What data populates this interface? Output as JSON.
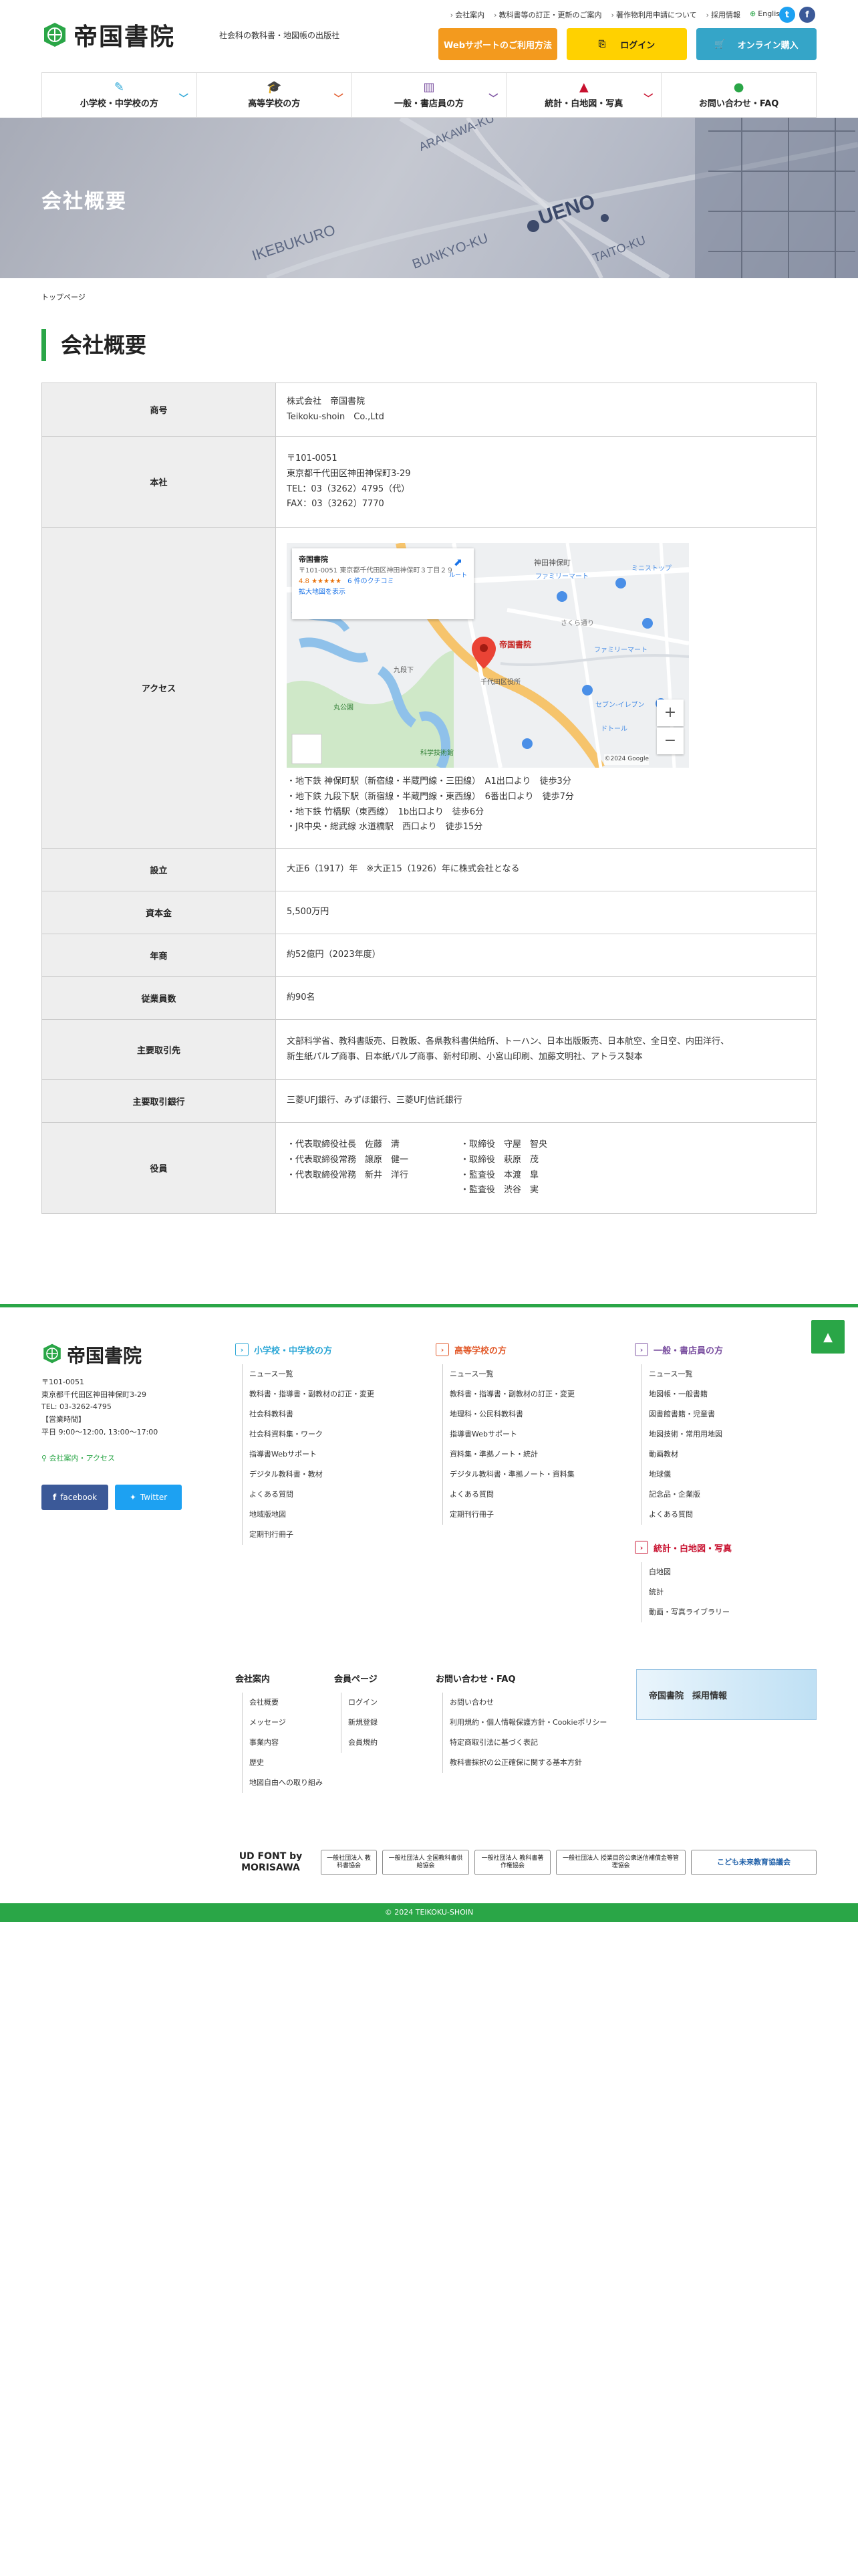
{
  "header": {
    "logo": "帝国書院",
    "tagline": "社会科の教科書・地図帳の出版社",
    "toplinks": [
      "会社案内",
      "教科書等の訂正・更新のご案内",
      "著作物利用申請について",
      "採用情報",
      "English"
    ],
    "buttons": {
      "web_support": "Webサポートのご利用方法",
      "login": "ログイン",
      "online": "オンライン購入"
    }
  },
  "nav": [
    "小学校・中学校の方",
    "高等学校の方",
    "一般・書店員の方",
    "統計・白地図・写真",
    "お問い合わせ・FAQ"
  ],
  "hero": {
    "title": "会社概要"
  },
  "breadcrumb": "トップページ",
  "page_title": "会社概要",
  "company": {
    "name_label": "商号",
    "name_lines": [
      "株式会社　帝国書院",
      "Teikoku-shoin　Co.,Ltd"
    ],
    "office_label": "本社",
    "office_lines": [
      "〒101-0051",
      "東京都千代田区神田神保町3-29",
      "TEL：03（3262）4795（代）",
      "FAX：03（3262）7770"
    ],
    "access_label": "アクセス",
    "map": {
      "card_title": "帝国書院",
      "card_address": "〒101-0051 東京都千代田区神田神保町３丁目２９",
      "card_rating": "4.8 ★★★★★",
      "card_reviews": "6 件のクチコミ",
      "card_link": "拡大地図を表示",
      "route": "ルート",
      "marker": "帝国書院",
      "labels": [
        "神田神保町",
        "ファミリーマート",
        "さくら通り",
        "ファミリーマート",
        "セブン-イレブン",
        "千代田区役所",
        "丸公園",
        "科学技術館",
        "ミニストップ",
        "ドトール",
        "九段下"
      ],
      "zoom_in": "+",
      "zoom_out": "−",
      "copyright": "©2024 Google"
    },
    "access_lines": [
      "・地下鉄 神保町駅（新宿線・半蔵門線・三田線）　A1出口より　徒歩3分",
      "・地下鉄 九段下駅（新宿線・半蔵門線・東西線）　6番出口より　徒歩7分",
      "・地下鉄 竹橋駅（東西線）　1b出口より　徒歩6分",
      "・JR中央・総武線 水道橋駅　西口より　徒歩15分"
    ],
    "founded_label": "設立",
    "founded": "大正6（1917）年　※大正15（1926）年に株式会社となる",
    "capital_label": "資本金",
    "capital": "5,500万円",
    "sales_label": "年商",
    "sales": "約52億円（2023年度）",
    "employees_label": "従業員数",
    "employees": "約90名",
    "clients_label": "主要取引先",
    "clients_lines": [
      "文部科学省、教科書販売、日教販、各県教科書供給所、トーハン、日本出版販売、日本航空、全日空、内田洋行、",
      "新生紙パルプ商事、日本紙パルプ商事、新村印刷、小宮山印刷、加藤文明社、アトラス製本"
    ],
    "banks_label": "主要取引銀行",
    "banks": "三菱UFJ銀行、みずほ銀行、三菱UFJ信託銀行",
    "officers_label": "役員",
    "officers_left": [
      "・代表取締役社長　佐藤　清",
      "・代表取締役常務　譲原　健一",
      "・代表取締役常務　新井　洋行"
    ],
    "officers_right": [
      "・取締役　守屋　智央",
      "・取締役　萩原　茂",
      "・監査役　本渡　皐",
      "・監査役　渋谷　実"
    ]
  },
  "footer": {
    "logo": "帝国書院",
    "address_lines": [
      "〒101-0051",
      "東京都千代田区神田神保町3-29",
      "TEL: 03-3262-4795",
      "【営業時間】",
      "平日 9:00〜12:00, 13:00〜17:00"
    ],
    "access_link": "会社案内・アクセス",
    "facebook": "facebook",
    "twitter": "Twitter",
    "col1": {
      "title": "小学校・中学校の方",
      "items": [
        "ニュース一覧",
        "教科書・指導書・副教材の訂正・変更",
        "社会科教科書",
        "社会科資料集・ワーク",
        "指導書Webサポート",
        "デジタル教科書・教材",
        "よくある質問",
        "地域版地図",
        "定期刊行冊子"
      ]
    },
    "col2": {
      "title": "高等学校の方",
      "items": [
        "ニュース一覧",
        "教科書・指導書・副教材の訂正・変更",
        "地理科・公民科教科書",
        "指導書Webサポート",
        "資料集・準拠ノート・統計",
        "デジタル教科書・準拠ノート・資料集",
        "よくある質問",
        "定期刊行冊子"
      ]
    },
    "col3": {
      "title": "一般・書店員の方",
      "items": [
        "ニュース一覧",
        "地図帳・一般書籍",
        "図書館書籍・児童書",
        "地図技術・常用用地図",
        "動画教材",
        "地球儀",
        "記念品・企業版",
        "よくある質問"
      ]
    },
    "col4": {
      "title": "統計・白地図・写真",
      "items": [
        "白地図",
        "統計",
        "動画・写真ライブラリー"
      ]
    },
    "sec1": {
      "title": "会社案内",
      "items": [
        "会社概要",
        "メッセージ",
        "事業内容",
        "歴史",
        "地図自由への取り組み"
      ]
    },
    "sec2": {
      "title": "会員ページ",
      "items": [
        "ログイン",
        "新規登録",
        "会員規約"
      ]
    },
    "sec3": {
      "title": "お問い合わせ・FAQ",
      "items": [
        "お問い合わせ",
        "利用規約・個人情報保護方針・Cookieポリシー",
        "特定商取引法に基づく表記",
        "教科書採択の公正確保に関する基本方針"
      ]
    },
    "recruit": "帝国書院　採用情報",
    "pagetop": "▲",
    "associations": [
      "UD FONT by MORISAWA",
      "一般社団法人 教科書協会",
      "一般社団法人 全国教科書供給協会",
      "一般社団法人 教科書著作権協会",
      "一般社団法人 授業目的公衆送信補償金等管理協会",
      "こども未来教育協議会"
    ],
    "copyright": "© 2024 TEIKOKU-SHOIN"
  },
  "colors": {
    "green": "#2aa647",
    "orange": "#f39a1e",
    "yellow": "#ffd100",
    "teal": "#35a5c8",
    "blue_col": "#2aa6d6",
    "red_col": "#e25a2b",
    "purple_col": "#7a4fa0",
    "crimson_col": "#c8102e"
  }
}
